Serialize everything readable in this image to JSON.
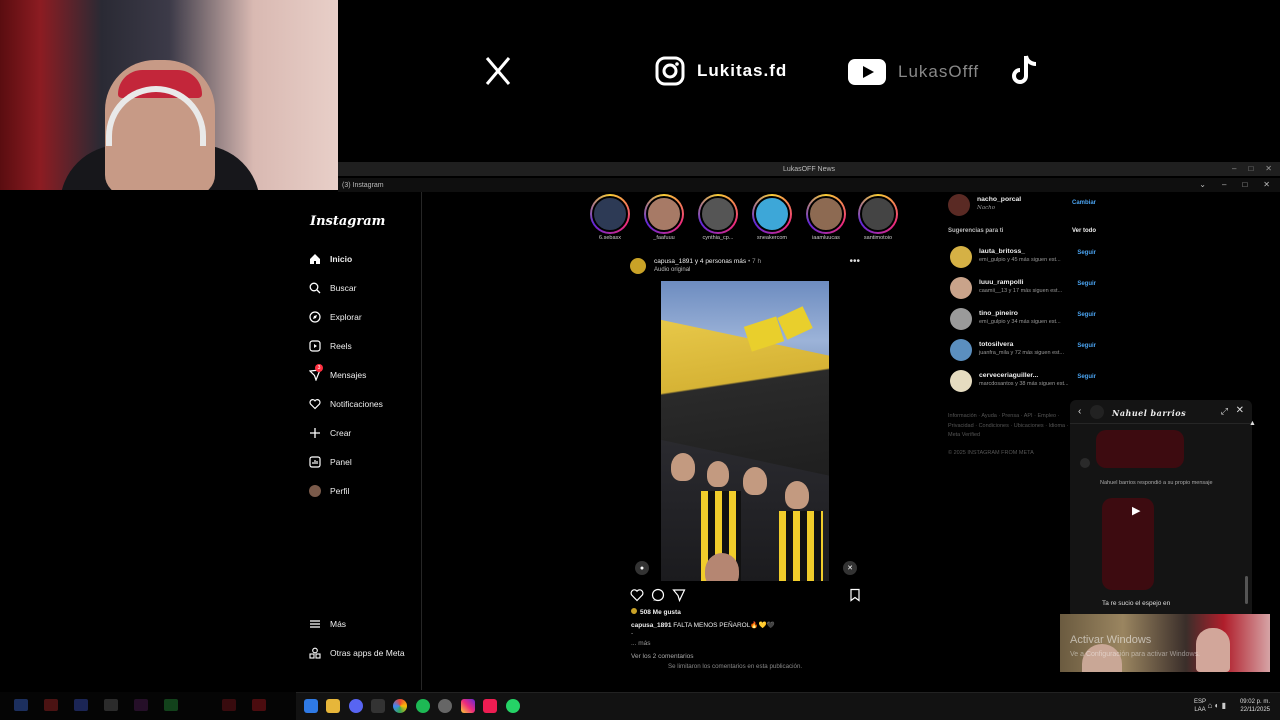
{
  "overlay": {
    "instagram_handle": "Lukitas.fd",
    "youtube_handle": "LukasOfff"
  },
  "window": {
    "title": "LukasOFF News",
    "browser_tab": "(3) Instagram"
  },
  "sidebar": {
    "logo": "Instagram",
    "items": [
      {
        "label": "Inicio",
        "icon": "home-icon"
      },
      {
        "label": "Buscar",
        "icon": "search-icon"
      },
      {
        "label": "Explorar",
        "icon": "compass-icon"
      },
      {
        "label": "Reels",
        "icon": "reels-icon"
      },
      {
        "label": "Mensajes",
        "icon": "messenger-icon",
        "badge": "3"
      },
      {
        "label": "Notificaciones",
        "icon": "heart-icon"
      },
      {
        "label": "Crear",
        "icon": "plus-icon"
      },
      {
        "label": "Panel",
        "icon": "dashboard-icon"
      },
      {
        "label": "Perfil",
        "icon": "profile-avatar"
      }
    ],
    "more": "Más",
    "meta_apps": "Otras apps de Meta"
  },
  "stories": [
    {
      "name": "6.sebasx"
    },
    {
      "name": "_faafuuu"
    },
    {
      "name": "cynthia_cp..."
    },
    {
      "name": "sneakercom"
    },
    {
      "name": "iaamluucas"
    },
    {
      "name": "santimotoio"
    }
  ],
  "post": {
    "user_line": "capusa_1891 y 4 personas más",
    "time": "• 7 h",
    "audio": "Audio original",
    "likes": "508 Me gusta",
    "caption_user": "capusa_1891",
    "caption_text": "FALTA MENOS PEÑAROL🔥💛🖤",
    "caption_dash": "-",
    "more": "... más",
    "view_comments": "Ver los 2 comentarios",
    "comments_limited": "Se limitaron los comentarios en esta publicación."
  },
  "right": {
    "me_user": "nacho_porcal",
    "me_name": "Nacho",
    "switch": "Cambiar",
    "suggestions_title": "Sugerencias para ti",
    "see_all": "Ver todo",
    "suggestions": [
      {
        "user": "lauta_britoss_",
        "sub": "emi_gulpio y 45 más siguen est...",
        "action": "Seguir"
      },
      {
        "user": "luuu_rampolli",
        "sub": "caamii__13 y 17 más siguen est...",
        "action": "Seguir"
      },
      {
        "user": "tino_pineiro",
        "sub": "emi_gulpio y 34 más siguen est...",
        "action": "Seguir"
      },
      {
        "user": "totosilvera",
        "sub": "juanfra_mila y 72 más siguen est...",
        "action": "Seguir"
      },
      {
        "user": "cerveceriaguiller...",
        "sub": "marcdosantos y 38 más siguen est...",
        "action": "Seguir"
      }
    ],
    "footer": "Información · Ayuda · Prensa · API · Empleo · Privacidad · Condiciones · Ubicaciones · Idioma · Meta Verified",
    "copyright": "© 2025 INSTAGRAM FROM META"
  },
  "chat": {
    "title": "Nahuel barrios",
    "note": "Nahuel barrios respondió a su propio mensaje",
    "last_message": "Ta re sucio el espejo en"
  },
  "watermark": {
    "line1": "Activar Windows",
    "line2": "Ve a Configuración para activar Windows."
  },
  "taskbar": {
    "lang_top": "ESP",
    "lang_bottom": "LAA",
    "time": "09:02 p. m.",
    "date": "22/11/2025"
  },
  "colors": {
    "accent_blue": "#4aa3f0",
    "story_ring": "#ee2a7b",
    "penarol_yellow": "#f1cd2b"
  }
}
